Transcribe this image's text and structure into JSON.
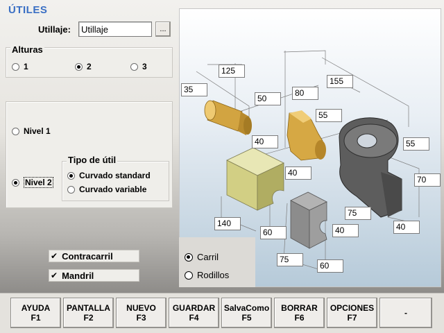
{
  "window": {
    "title": "ÚTILES"
  },
  "utillaje": {
    "label": "Utillaje:",
    "value": "Utillaje",
    "browse_label": "..."
  },
  "alturas": {
    "title": "Alturas",
    "options": [
      "1",
      "2",
      "3"
    ],
    "selected": "2"
  },
  "nivel": {
    "options": [
      "Nivel 1",
      "Nivel 2"
    ],
    "selected": "Nivel 2"
  },
  "tipo_util": {
    "title": "Tipo de útil",
    "options": [
      "Curvado standard",
      "Curvado variable"
    ],
    "selected": "Curvado standard"
  },
  "checks": {
    "contracarril": {
      "label": "Contracarril",
      "checked": true
    },
    "mandril": {
      "label": "Mandril",
      "checked": true
    }
  },
  "dimensions": [
    "125",
    "35",
    "50",
    "80",
    "155",
    "55",
    "40",
    "55",
    "40",
    "70",
    "75",
    "140",
    "60",
    "40",
    "40",
    "75",
    "60"
  ],
  "carril_rodillos": {
    "options": [
      "Carril",
      "Rodillos"
    ],
    "selected": "Carril"
  },
  "footer": {
    "buttons": [
      {
        "label": "AYUDA",
        "key": "F1"
      },
      {
        "label": "PANTALLA",
        "key": "F2"
      },
      {
        "label": "NUEVO",
        "key": "F3"
      },
      {
        "label": "GUARDAR",
        "key": "F4"
      },
      {
        "label": "SalvaComo",
        "key": "F5"
      },
      {
        "label": "BORRAR",
        "key": "F6"
      },
      {
        "label": "OPCIONES",
        "key": "F7"
      },
      {
        "label": "-",
        "key": ""
      }
    ]
  }
}
